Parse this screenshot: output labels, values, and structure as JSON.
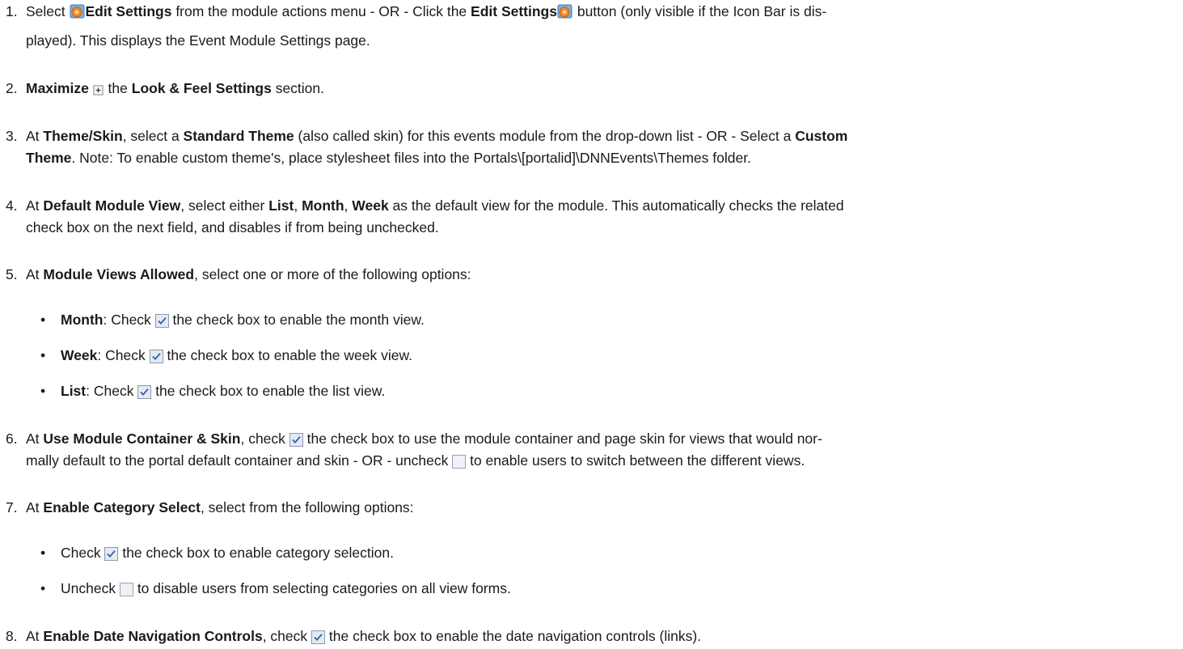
{
  "icons": {
    "settings": "edit-settings-icon",
    "maximize": "maximize-icon",
    "checked": "checked-checkbox-icon",
    "unchecked": "unchecked-checkbox-icon"
  },
  "steps": {
    "s1": {
      "num": "1.",
      "a": "Select ",
      "b": "Edit Settings",
      "c": " from the module actions menu - OR - Click the ",
      "d": "Edit Settings",
      "e": " button (only visible if the Icon Bar is dis-",
      "l2": "played). This displays the Event Module Settings page."
    },
    "s2": {
      "num": "2.",
      "a": "Maximize",
      "b": " the ",
      "c": "Look & Feel Settings",
      "d": " section."
    },
    "s3": {
      "num": "3.",
      "a": "At ",
      "b": "Theme/Skin",
      "c": ", select a ",
      "d": "Standard Theme",
      "e": " (also called skin) for this events module from the drop-down list - OR - Select a ",
      "f": "Custom",
      "l2b": "Theme",
      "l2": ". Note: To enable custom theme's, place stylesheet files into the Portals\\[portalid]\\DNNEvents\\Themes folder."
    },
    "s4": {
      "num": "4.",
      "a": "At ",
      "b": "Default Module View",
      "c": ", select either ",
      "d": "List",
      "e": ", ",
      "f": "Month",
      "g": ", ",
      "h": "Week",
      "i": " as the default view for the module. This automatically checks the related",
      "l2": "check box on the next field, and disables if from being unchecked."
    },
    "s5": {
      "num": "5.",
      "a": "At ",
      "b": "Module Views Allowed",
      "c": ", select one or more of the following options:",
      "bullets": [
        {
          "b": "Month",
          "a": ": Check ",
          "c": " the check box to enable the month view."
        },
        {
          "b": "Week",
          "a": ": Check ",
          "c": " the check box to enable the week view."
        },
        {
          "b": "List",
          "a": ": Check ",
          "c": " the check box to enable the list view."
        }
      ]
    },
    "s6": {
      "num": "6.",
      "a": "At ",
      "b": "Use Module Container & Skin",
      "c": ", check ",
      "d": " the check box to use the module container and page skin for views that would nor-",
      "l2a": "mally default to the portal default container and skin - OR - uncheck ",
      "l2b": " to enable users to switch between the different views."
    },
    "s7": {
      "num": "7.",
      "a": "At ",
      "b": "Enable Category Select",
      "c": ", select from the following options:",
      "bullets": [
        {
          "a": "Check ",
          "c": " the check box to enable category selection."
        },
        {
          "a": "Uncheck ",
          "c": " to disable users from selecting categories on all view forms."
        }
      ]
    },
    "s8": {
      "num": "8.",
      "a": "At ",
      "b": "Enable Date Navigation Controls",
      "c": ", check ",
      "d": " the check box to enable the date navigation controls (links)."
    }
  }
}
